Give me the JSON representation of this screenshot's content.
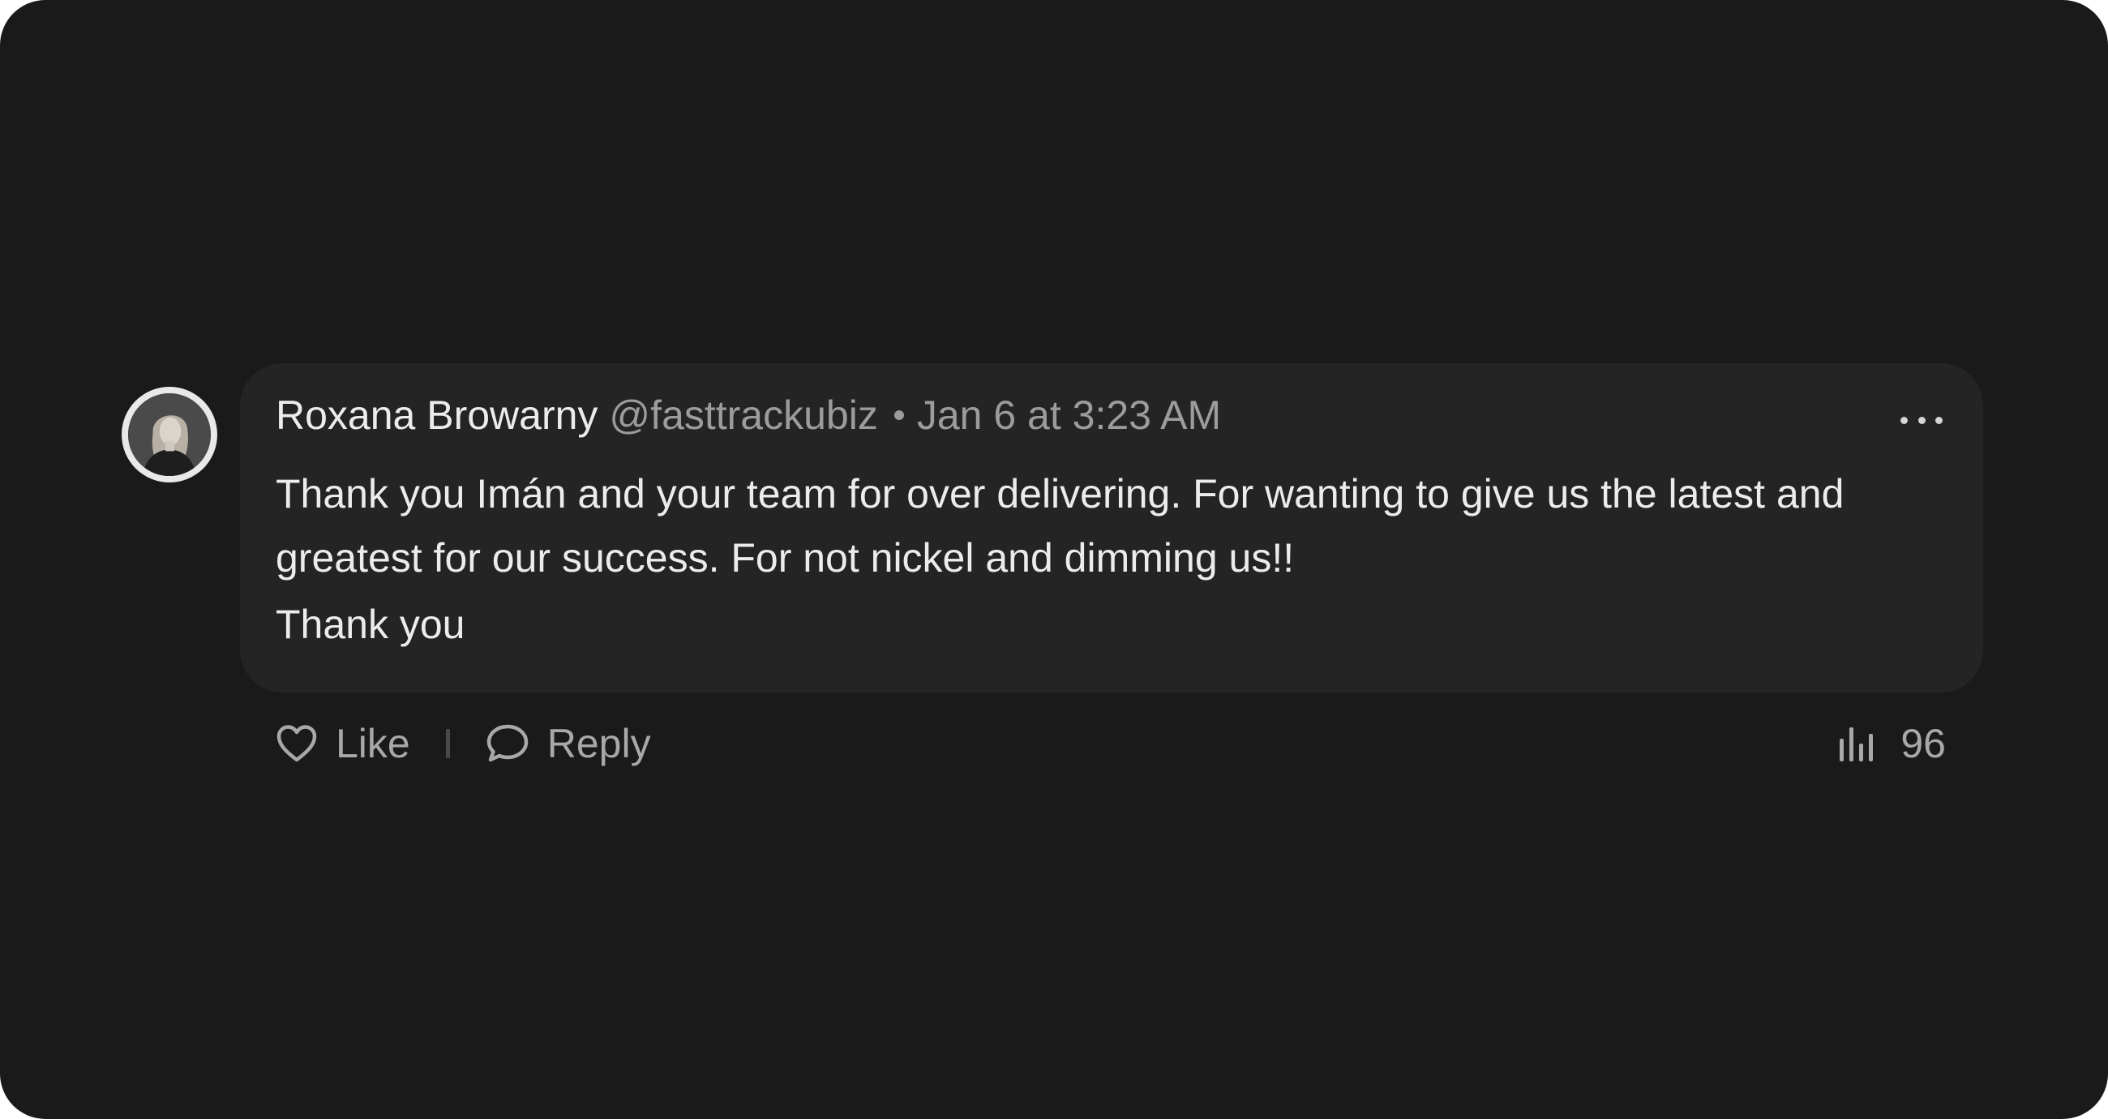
{
  "comment": {
    "author_name": "Roxana Browarny",
    "handle": "@fasttrackubiz",
    "timestamp": "Jan 6 at 3:23 AM",
    "body_line_1": "Thank you Imán and your team for over delivering. For wanting to give us the latest and greatest for our success. For not nickel and dimming us!!",
    "body_line_2": "Thank you",
    "more_icon": "more-horizontal-icon"
  },
  "actions": {
    "like_label": "Like",
    "like_icon": "heart-icon",
    "reply_label": "Reply",
    "reply_icon": "speech-bubble-icon",
    "views_icon": "bar-chart-icon",
    "views_count": "96"
  },
  "colors": {
    "background": "#1a1a1a",
    "bubble": "#242424",
    "primary_text": "#ececec",
    "secondary_text": "#9c9c9c"
  }
}
